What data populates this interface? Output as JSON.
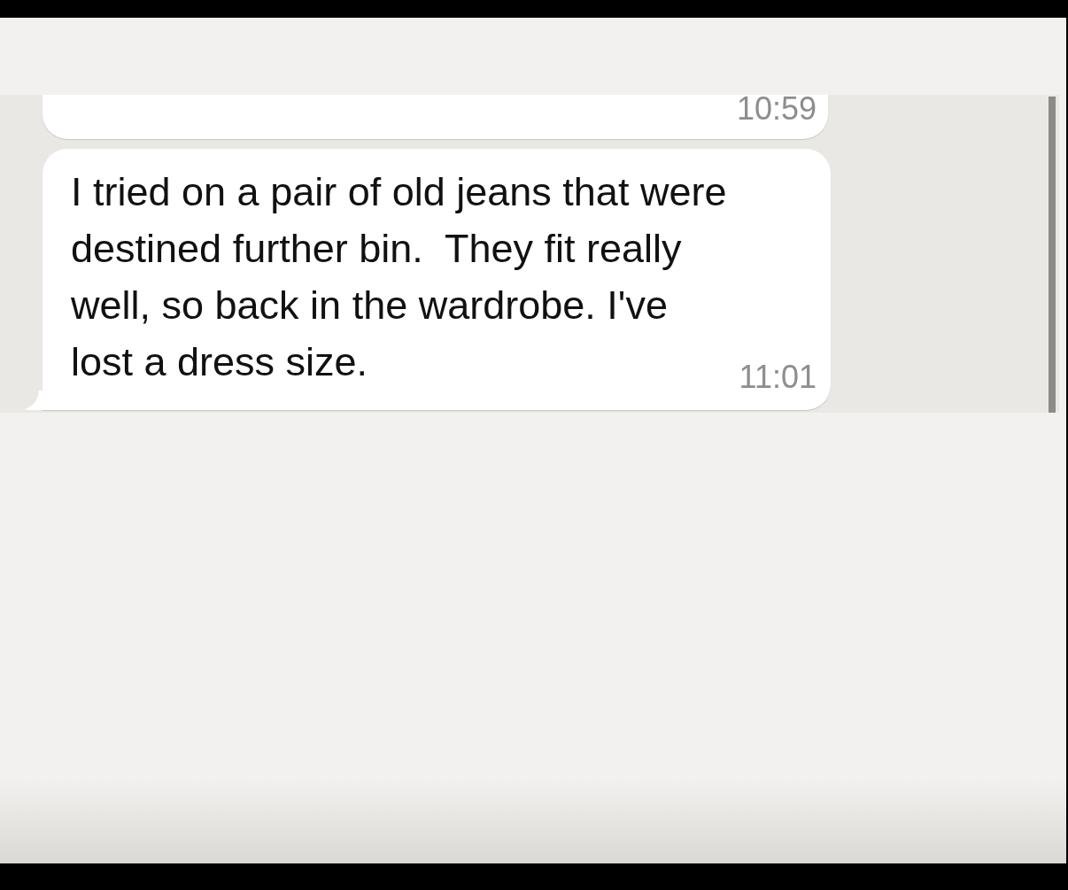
{
  "messages": [
    {
      "time": "10:59",
      "tail": false
    },
    {
      "text": "I tried on a pair of old jeans that were destined further bin.  They fit really well, so back in the wardrobe. I've lost a dress size.",
      "time": "11:01",
      "tail": true
    }
  ]
}
